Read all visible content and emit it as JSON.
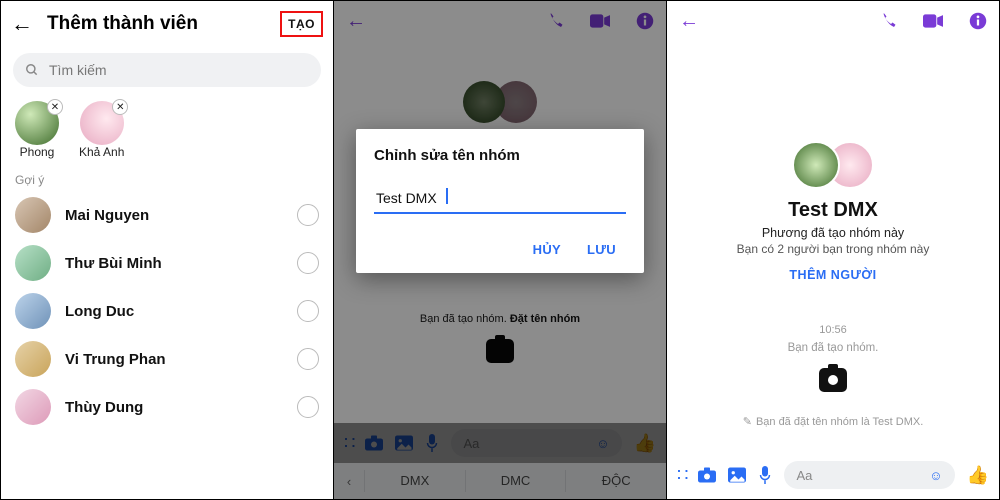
{
  "panel1": {
    "title": "Thêm thành viên",
    "create": "TẠO",
    "search_placeholder": "Tìm kiếm",
    "selected": [
      {
        "name": "Phong"
      },
      {
        "name": "Khả Anh"
      }
    ],
    "suggestion_label": "Gợi ý",
    "contacts": [
      {
        "name": "Mai Nguyen"
      },
      {
        "name": "Thư Bùi Minh"
      },
      {
        "name": "Long Duc"
      },
      {
        "name": "Vi Trung Phan"
      },
      {
        "name": "Thùy Dung"
      }
    ]
  },
  "panel2": {
    "created_line_a": "Bạn đã tạo nhóm.",
    "created_line_b": "Đặt tên nhóm",
    "dialog_title": "Chỉnh sửa tên nhóm",
    "dialog_value": "Test DMX",
    "cancel": "HỦY",
    "save": "LƯU",
    "composer_placeholder": "Aa",
    "suggestions": [
      "DMX",
      "DMC",
      "ĐỘC"
    ]
  },
  "panel3": {
    "group_name": "Test DMX",
    "creator_line": "Phương đã tạo nhóm này",
    "friends_line": "Bạn có 2 người bạn trong nhóm này",
    "add_people": "THÊM NGƯỜI",
    "time": "10:56",
    "made": "Bạn đã tạo nhóm.",
    "named_line": "Bạn đã đặt tên nhóm là Test DMX.",
    "composer_placeholder": "Aa"
  }
}
